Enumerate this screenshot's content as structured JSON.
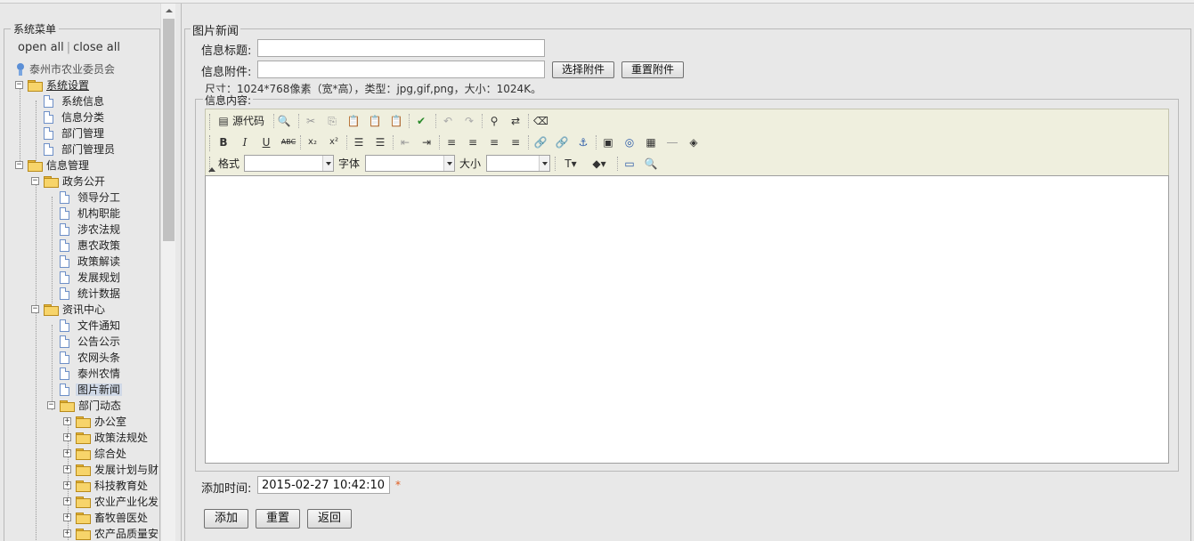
{
  "sidebar": {
    "legend": "系统菜单",
    "open_all": "open all",
    "separator": "|",
    "close_all": "close all",
    "root": "泰州市农业委员会",
    "nodes": [
      "系统设置",
      "系统信息",
      "信息分类",
      "部门管理",
      "部门管理员",
      "信息管理",
      "政务公开",
      "领导分工",
      "机构职能",
      "涉农法规",
      "惠农政策",
      "政策解读",
      "发展规划",
      "统计数据",
      "资讯中心",
      "文件通知",
      "公告公示",
      "农网头条",
      "泰州农情",
      "图片新闻",
      "部门动态",
      "办公室",
      "政策法规处",
      "综合处",
      "发展计划与财",
      "科技教育处",
      "农业产业化发",
      "畜牧兽医处",
      "农产品质量安"
    ]
  },
  "form": {
    "legend": "图片新闻",
    "title_label": "信息标题:",
    "title_value": "",
    "attach_label": "信息附件:",
    "attach_value": "",
    "choose_attach": "选择附件",
    "reset_attach": "重置附件",
    "hint": "尺寸：1024*768像素（宽*高），类型：jpg,gif,png，大小：1024K。",
    "content_legend": "信息内容:",
    "time_label": "添加时间:",
    "time_value": "2015-02-27 10:42:10",
    "required_mark": "*",
    "add": "添加",
    "reset": "重置",
    "back": "返回"
  },
  "toolbar": {
    "source": "源代码",
    "format_label": "格式",
    "font_label": "字体",
    "size_label": "大小",
    "bold": "B",
    "italic": "I",
    "underline": "U",
    "strike": "ABC"
  }
}
